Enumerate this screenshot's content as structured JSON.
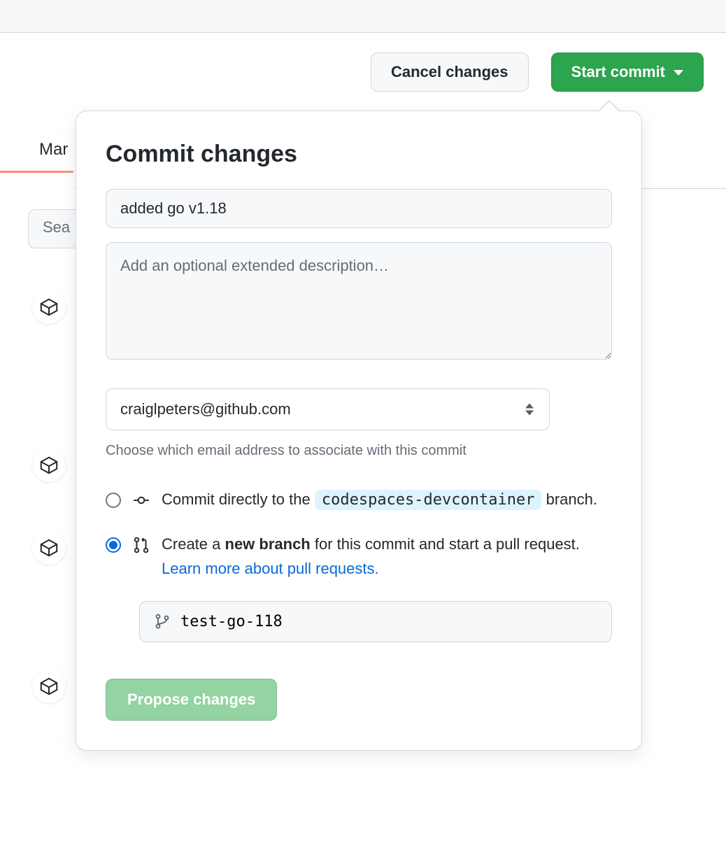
{
  "toolbar": {
    "cancel_label": "Cancel changes",
    "start_commit_label": "Start commit"
  },
  "tab": {
    "label": "Mar"
  },
  "search": {
    "placeholder": "Sea"
  },
  "commit_panel": {
    "title": "Commit changes",
    "summary_value": "added go v1.18",
    "description_placeholder": "Add an optional extended description…",
    "email_selected": "craiglpeters@github.com",
    "email_helper": "Choose which email address to associate with this commit",
    "direct_commit": {
      "prefix": "Commit directly to the ",
      "branch": "codespaces-devcontainer",
      "suffix": " branch."
    },
    "new_branch": {
      "prefix": "Create a ",
      "bold": "new branch",
      "middle": " for this commit and start a pull request. ",
      "link": "Learn more about pull requests.",
      "branch_value": "test-go-118"
    },
    "propose_label": "Propose changes"
  }
}
